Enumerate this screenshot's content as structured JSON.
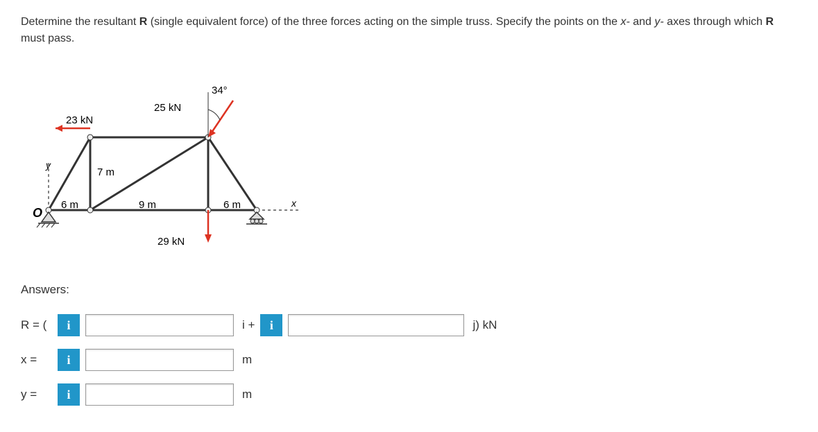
{
  "problem": {
    "text_part1": "Determine the resultant ",
    "text_bold1": "R",
    "text_part2": " (single equivalent force) of the three forces acting on the simple truss. Specify the points on the ",
    "text_italic1": "x-",
    "text_part3": " and ",
    "text_italic2": "y-",
    "text_part4": " axes through which ",
    "text_bold2": "R",
    "text_part5": " must pass."
  },
  "diagram": {
    "angle": "34°",
    "force_25": "25 kN",
    "force_23": "23 kN",
    "force_29": "29 kN",
    "dim_7m": "7 m",
    "dim_6m_left": "6 m",
    "dim_9m": "9 m",
    "dim_6m_right": "6 m",
    "y_axis": "y",
    "x_axis": "x",
    "origin": "O"
  },
  "answers": {
    "header": "Answers:",
    "r_label": "R = (",
    "r_mid": "i +",
    "r_unit": "j) kN",
    "x_label": "x =",
    "x_unit": "m",
    "y_label": "y =",
    "y_unit": "m",
    "info": "i"
  }
}
